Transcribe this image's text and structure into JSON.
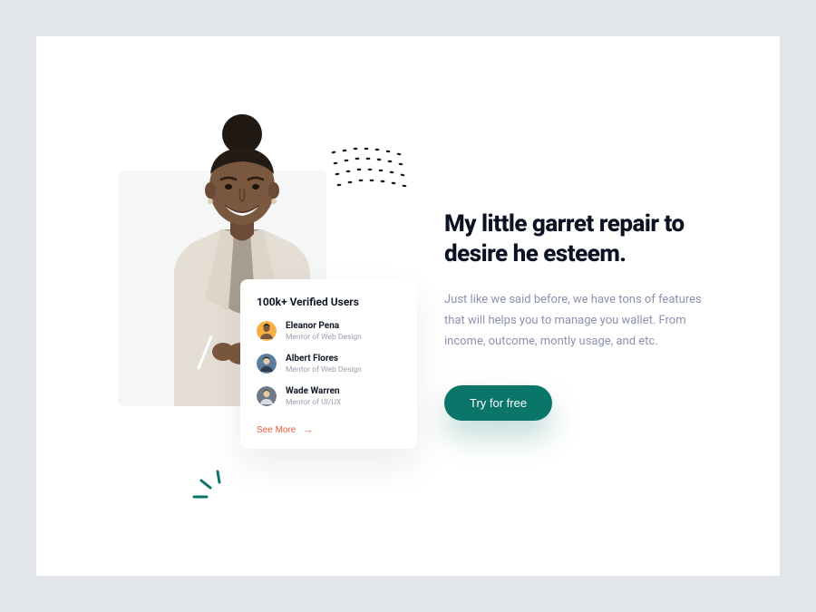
{
  "hero": {
    "headline": "My little garret repair to desire he esteem.",
    "body": "Just like we said before, we have tons of features that will helps you to manage you wallet. From income, outcome, montly usage, and etc.",
    "cta_label": "Try for free"
  },
  "card": {
    "title": "100k+ Verified Users",
    "see_more_label": "See More",
    "users": [
      {
        "name": "Eleanor Pena",
        "role": "Mentor of Web Design",
        "avatar_bg": "#f5b041"
      },
      {
        "name": "Albert Flores",
        "role": "Mentor of Web Design",
        "avatar_bg": "#5b7d9e"
      },
      {
        "name": "Wade Warren",
        "role": "Mentor of UI/UX",
        "avatar_bg": "#6d7a88"
      }
    ]
  },
  "colors": {
    "accent": "#0a766a",
    "link": "#f05a3a"
  }
}
